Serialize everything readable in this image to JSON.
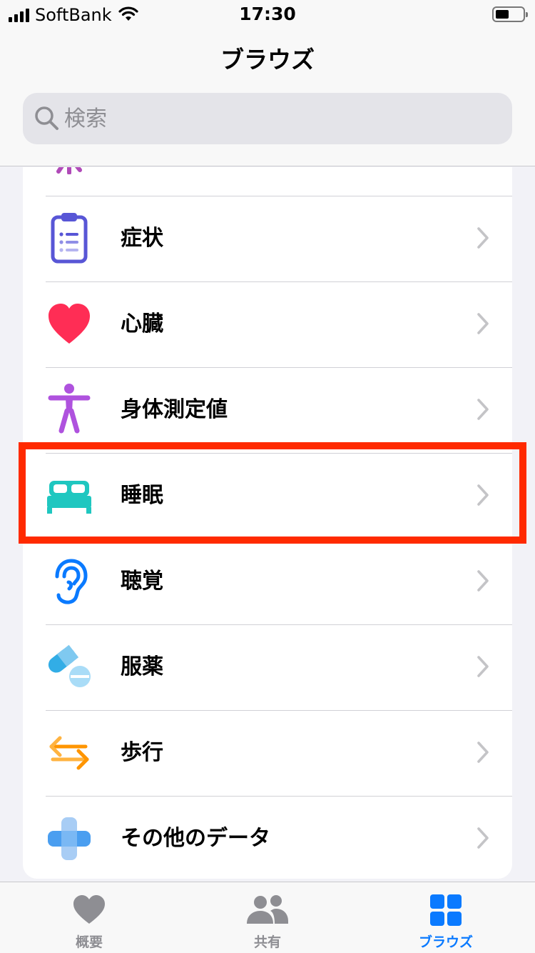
{
  "status_bar": {
    "carrier": "SoftBank",
    "time": "17:30"
  },
  "header": {
    "title": "ブラウズ",
    "search_placeholder": "検索"
  },
  "categories": [
    {
      "label": "症状",
      "icon": "clipboard-icon",
      "color": "#5856d6"
    },
    {
      "label": "心臓",
      "icon": "heart-icon",
      "color": "#ff2d55"
    },
    {
      "label": "身体測定値",
      "icon": "figure-icon",
      "color": "#af52de"
    },
    {
      "label": "睡眠",
      "icon": "bed-icon",
      "color": "#1fc7c0",
      "highlighted": true
    },
    {
      "label": "聴覚",
      "icon": "ear-icon",
      "color": "#0a7aff"
    },
    {
      "label": "服薬",
      "icon": "pills-icon",
      "color": "#32ade6"
    },
    {
      "label": "歩行",
      "icon": "arrows-icon",
      "color": "#ff9500"
    },
    {
      "label": "その他のデータ",
      "icon": "plus-icon",
      "color": "#5aa6f0"
    }
  ],
  "tab_bar": {
    "tabs": [
      {
        "label": "概要",
        "icon": "heart-icon",
        "active": false
      },
      {
        "label": "共有",
        "icon": "people-icon",
        "active": false
      },
      {
        "label": "ブラウズ",
        "icon": "grid-icon",
        "active": true
      }
    ],
    "active_color": "#0a7aff",
    "inactive_color": "#8e8e93"
  },
  "highlight_color": "#ff2a00"
}
